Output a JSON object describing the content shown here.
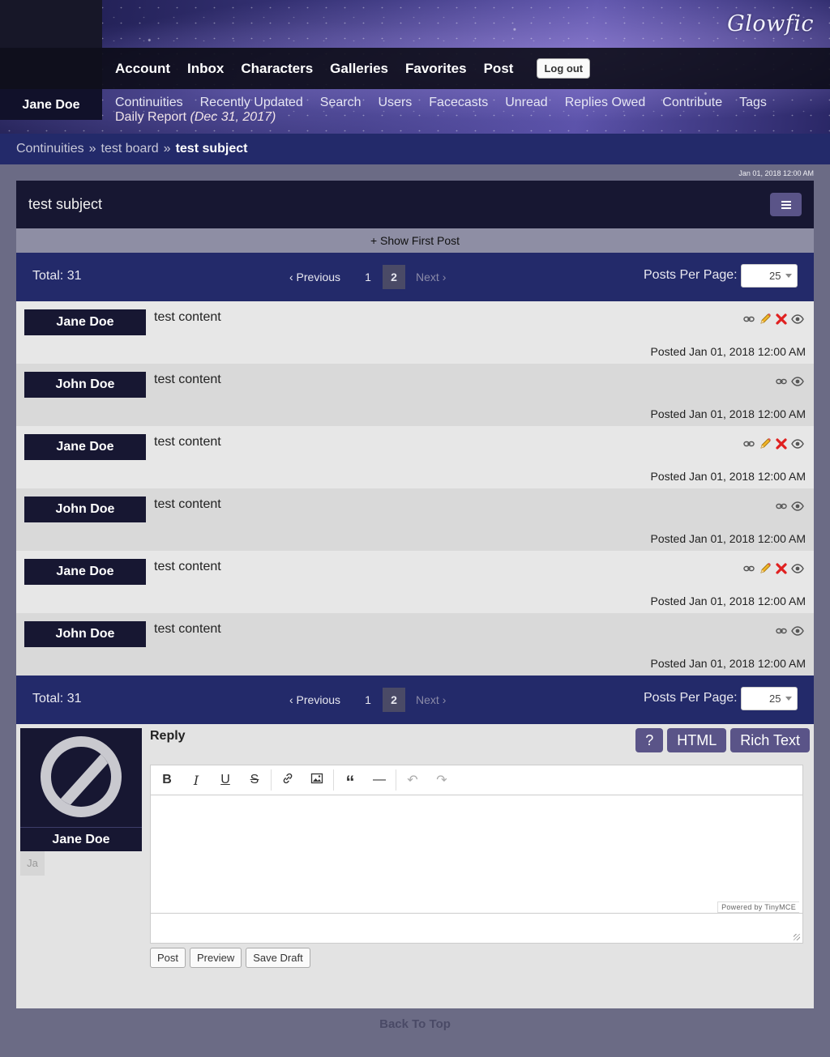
{
  "header": {
    "logo": "Glowfic",
    "username": "Jane Doe",
    "nav": [
      "Account",
      "Inbox",
      "Characters",
      "Galleries",
      "Favorites",
      "Post"
    ],
    "logout_label": "Log out",
    "subnav": [
      "Continuities",
      "Recently Updated",
      "Search",
      "Users",
      "Facecasts",
      "Unread",
      "Replies Owed",
      "Contribute",
      "Tags"
    ],
    "daily_report": "Daily Report",
    "daily_report_date": "(Dec 31, 2017)"
  },
  "breadcrumb": {
    "items": [
      "Continuities",
      "test board"
    ],
    "separator": "»",
    "current": "test subject"
  },
  "timestamp": "Jan 01, 2018 12:00 AM",
  "post_title": "test subject",
  "show_first_post": "+ Show First Post",
  "pager": {
    "total": "Total: 31",
    "prev": "‹ Previous",
    "pages": [
      "1",
      "2"
    ],
    "current_page": "2",
    "next": "Next ›",
    "ppp_label": "Posts Per Page:",
    "ppp_value": "25"
  },
  "replies": [
    {
      "author": "Jane Doe",
      "content": "test content",
      "posted": "Posted Jan 01, 2018 12:00 AM",
      "icons": [
        "link-icon",
        "edit-icon",
        "delete-icon",
        "eye-icon"
      ]
    },
    {
      "author": "John Doe",
      "content": "test content",
      "posted": "Posted Jan 01, 2018 12:00 AM",
      "icons": [
        "link-icon",
        "eye-icon"
      ]
    },
    {
      "author": "Jane Doe",
      "content": "test content",
      "posted": "Posted Jan 01, 2018 12:00 AM",
      "icons": [
        "link-icon",
        "edit-icon",
        "delete-icon",
        "eye-icon"
      ]
    },
    {
      "author": "John Doe",
      "content": "test content",
      "posted": "Posted Jan 01, 2018 12:00 AM",
      "icons": [
        "link-icon",
        "eye-icon"
      ]
    },
    {
      "author": "Jane Doe",
      "content": "test content",
      "posted": "Posted Jan 01, 2018 12:00 AM",
      "icons": [
        "link-icon",
        "edit-icon",
        "delete-icon",
        "eye-icon"
      ]
    },
    {
      "author": "John Doe",
      "content": "test content",
      "posted": "Posted Jan 01, 2018 12:00 AM",
      "icons": [
        "link-icon",
        "eye-icon"
      ]
    }
  ],
  "reply_form": {
    "character_name": "Jane Doe",
    "character_short": "Ja",
    "title": "Reply",
    "help_label": "?",
    "html_label": "HTML",
    "rich_text_label": "Rich Text",
    "powered_by": "Powered by TinyMCE",
    "post_label": "Post",
    "preview_label": "Preview",
    "save_draft_label": "Save Draft"
  },
  "back_to_top": "Back To Top",
  "colors": {
    "accent": "#232a6a",
    "dark": "#171732",
    "button": "#5a5488"
  }
}
